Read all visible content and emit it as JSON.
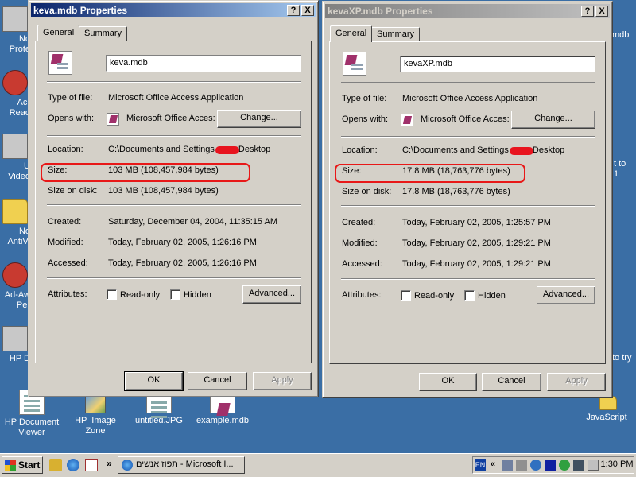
{
  "desktop": {
    "icons_left": [
      {
        "label": "No\nProte",
        "icon": "shield-icon"
      },
      {
        "label": "Acr\nRead",
        "icon": "acrobat-icon"
      },
      {
        "label": "U\nVideo",
        "icon": "video-icon"
      },
      {
        "label": "No\nAntiVi",
        "icon": "antivirus-icon"
      },
      {
        "label": "Ad-Aw\nPer",
        "icon": "adaware-icon"
      },
      {
        "label": "HP D",
        "icon": "hp-icon"
      }
    ],
    "icons_bottom": [
      {
        "label": "HP Document\nViewer",
        "icon": "hp-document-viewer-icon"
      },
      {
        "label": "HP  Image\nZone",
        "icon": "hp-image-zone-icon"
      },
      {
        "label": "untitled.JPG",
        "icon": "jpg-file-icon"
      },
      {
        "label": "example.mdb",
        "icon": "mdb-file-icon"
      }
    ],
    "icons_right": [
      {
        "label": "mdb",
        "icon": "mdb-file-icon"
      },
      {
        "label": "t to\n1",
        "icon": "shortcut-icon"
      },
      {
        "label": "to try",
        "icon": "trial-icon"
      },
      {
        "label": "JavaScript",
        "icon": "folder-icon"
      }
    ]
  },
  "dialog_left": {
    "title": "keva.mdb Properties",
    "help_btn": "?",
    "close_btn": "X",
    "tabs": [
      "General",
      "Summary"
    ],
    "filename": "keva.mdb",
    "type_label": "Type of file:",
    "type_value": "Microsoft Office Access Application",
    "opens_label": "Opens with:",
    "opens_value": "Microsoft Office Acces:",
    "change_btn": "Change...",
    "location_label": "Location:",
    "location_pre": "C:\\Documents and Settings",
    "location_post": "Desktop",
    "size_label": "Size:",
    "size_value": "103 MB (108,457,984 bytes)",
    "sizedisk_label": "Size on disk:",
    "sizedisk_value": "103 MB (108,457,984 bytes)",
    "created_label": "Created:",
    "created_value": "Saturday, December 04, 2004, 11:35:15 AM",
    "modified_label": "Modified:",
    "modified_value": "Today, February 02, 2005, 1:26:16 PM",
    "accessed_label": "Accessed:",
    "accessed_value": "Today, February 02, 2005, 1:26:16 PM",
    "attributes_label": "Attributes:",
    "readonly_label": "Read-only",
    "hidden_label": "Hidden",
    "advanced_btn": "Advanced...",
    "ok_btn": "OK",
    "cancel_btn": "Cancel",
    "apply_btn": "Apply"
  },
  "dialog_right": {
    "title": "kevaXP.mdb Properties",
    "help_btn": "?",
    "close_btn": "X",
    "tabs": [
      "General",
      "Summary"
    ],
    "filename": "kevaXP.mdb",
    "type_label": "Type of file:",
    "type_value": "Microsoft Office Access Application",
    "opens_label": "Opens with:",
    "opens_value": "Microsoft Office Acces:",
    "change_btn": "Change...",
    "location_label": "Location:",
    "location_pre": "C:\\Documents and Settings",
    "location_post": "Desktop",
    "size_label": "Size:",
    "size_value": "17.8 MB (18,763,776 bytes)",
    "sizedisk_label": "Size on disk:",
    "sizedisk_value": "17.8 MB (18,763,776 bytes)",
    "created_label": "Created:",
    "created_value": "Today, February 02, 2005, 1:25:57 PM",
    "modified_label": "Modified:",
    "modified_value": "Today, February 02, 2005, 1:29:21 PM",
    "accessed_label": "Accessed:",
    "accessed_value": "Today, February 02, 2005, 1:29:21 PM",
    "attributes_label": "Attributes:",
    "readonly_label": "Read-only",
    "hidden_label": "Hidden",
    "advanced_btn": "Advanced...",
    "ok_btn": "OK",
    "cancel_btn": "Cancel",
    "apply_btn": "Apply"
  },
  "taskbar": {
    "start_label": "Start",
    "overflow": "»",
    "task_item": "תפוז אנשים - Microsoft I...",
    "lang": "EN",
    "tray_expand": "«",
    "clock": "1:30 PM"
  },
  "colors": {
    "desktop": "#3a6ea5",
    "highlight": "#e81818",
    "active_title": "#0a246a"
  }
}
